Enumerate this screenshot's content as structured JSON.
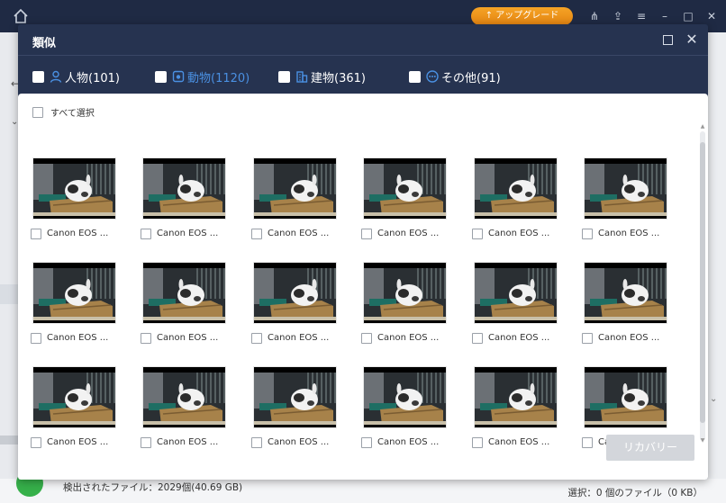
{
  "app": {
    "upgrade_label": "アップグレード",
    "found_text": "検出されたファイル：2029個(40.69 GB)",
    "selection_text": "選択：0 個のファイル（0 KB）"
  },
  "dialog": {
    "title": "類似",
    "categories": [
      {
        "label": "人物(101)",
        "icon": "person-icon",
        "active": false
      },
      {
        "label": "動物(1120)",
        "icon": "animal-icon",
        "active": true
      },
      {
        "label": "建物(361)",
        "icon": "building-icon",
        "active": false
      },
      {
        "label": "その他(91)",
        "icon": "other-icon",
        "active": false
      }
    ],
    "select_all_label": "すべて選択",
    "items": [
      {
        "name": "Canon EOS ..."
      },
      {
        "name": "Canon EOS ..."
      },
      {
        "name": "Canon EOS ..."
      },
      {
        "name": "Canon EOS ..."
      },
      {
        "name": "Canon EOS ..."
      },
      {
        "name": "Canon EOS ..."
      },
      {
        "name": "Canon EOS ..."
      },
      {
        "name": "Canon EOS ..."
      },
      {
        "name": "Canon EOS ..."
      },
      {
        "name": "Canon EOS ..."
      },
      {
        "name": "Canon EOS ..."
      },
      {
        "name": "Canon EOS ..."
      },
      {
        "name": "Canon EOS ..."
      },
      {
        "name": "Canon EOS ..."
      },
      {
        "name": "Canon EOS ..."
      },
      {
        "name": "Canon EOS ..."
      },
      {
        "name": "Canon EOS ..."
      },
      {
        "name": "Canon EOS ..."
      }
    ],
    "recover_label": "リカバリー"
  },
  "colors": {
    "dialog_bg": "#263350",
    "accent": "#4a90e2",
    "upgrade": "#f0961c",
    "recover_disabled": "#d3d6db"
  }
}
